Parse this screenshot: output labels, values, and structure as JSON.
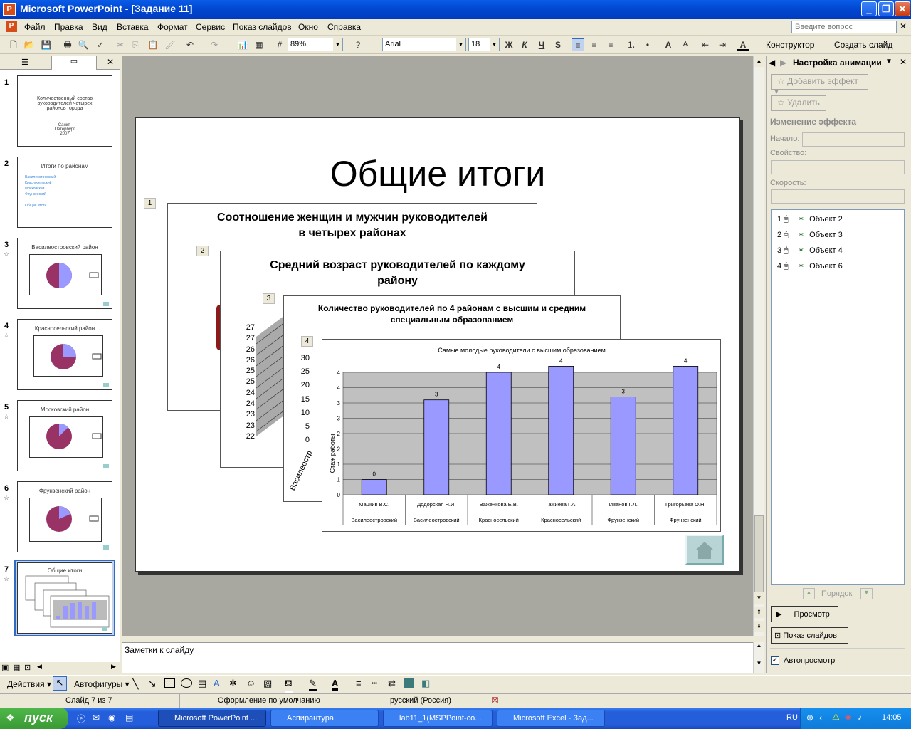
{
  "window": {
    "title": "Microsoft PowerPoint - [Задание 11]",
    "app_icon": "P"
  },
  "menu": [
    "Файл",
    "Правка",
    "Вид",
    "Вставка",
    "Формат",
    "Сервис",
    "Показ слайдов",
    "Окно",
    "Справка"
  ],
  "help_placeholder": "Введите вопрос",
  "toolbar": {
    "zoom": "89%",
    "font": "Arial",
    "size": "18",
    "designer": "Конструктор",
    "new_slide": "Создать слайд",
    "bold": "Ж",
    "italic": "К",
    "underline": "Ч",
    "shadow": "S"
  },
  "thumbnails": [
    {
      "num": "1",
      "title": "Количественный состав руководителей четырех районов города",
      "sub": "Санкт- Петербург 2007"
    },
    {
      "num": "2",
      "title": "Итоги по районам",
      "links": [
        "Василеостровский",
        "Красносельский",
        "Московский",
        "Фрунзенский",
        "Общие итоги"
      ]
    },
    {
      "num": "3",
      "title": "Василеостровский район"
    },
    {
      "num": "4",
      "title": "Красносельский район"
    },
    {
      "num": "5",
      "title": "Московский район"
    },
    {
      "num": "6",
      "title": "Фрунзенский район"
    },
    {
      "num": "7",
      "title": "Общие итоги"
    }
  ],
  "slide": {
    "title": "Общие итоги",
    "objects": [
      {
        "num": "1",
        "title_line1": "Соотношение женщин и мужчин руководителей",
        "title_line2": "в четырех районах"
      },
      {
        "num": "2",
        "title_line1": "Средний возраст руководителей по каждому",
        "title_line2": "району",
        "yticks": [
          "27",
          "27",
          "26",
          "26",
          "25",
          "25",
          "24",
          "24",
          "23",
          "23",
          "22"
        ]
      },
      {
        "num": "3",
        "title_line1": "Количество руководителей по 4 районам с высшим и средним",
        "title_line2": "специальным образованием",
        "yticks": [
          "30",
          "25",
          "20",
          "15",
          "10",
          "5",
          "0"
        ],
        "xlabel_partial": "Василеостр"
      },
      {
        "num": "4"
      }
    ]
  },
  "chart_data": {
    "type": "bar",
    "title": "Самые молодые руководители с высшим образованием",
    "ylabel": "Стаж работы",
    "ylim": [
      0,
      4
    ],
    "yticks": [
      "4",
      "4",
      "3",
      "3",
      "2",
      "2",
      "1",
      "1",
      "0"
    ],
    "categories": [
      "Мацкив В.С.",
      "Додорская Н.И.",
      "Важенкова Е.В.",
      "Тажиева Г.А.",
      "Иванов Г.Л.",
      "Григорьева О.Н."
    ],
    "districts": [
      "Василеостровский",
      "Василеостровский",
      "Красносельский",
      "Красносельский",
      "Фрунзенский",
      "Фрунзенский"
    ],
    "values": [
      0.5,
      3.1,
      4.0,
      4.2,
      3.2,
      4.2
    ],
    "data_labels": [
      "0",
      "3",
      "4",
      "4",
      "3",
      "4"
    ],
    "bar_color": "#9999ff",
    "plot_bg": "#c0c0c0"
  },
  "notes": "Заметки к слайду",
  "task_pane": {
    "title": "Настройка анимации",
    "add_effect": "Добавить эффект",
    "remove": "Удалить",
    "change_effect": "Изменение эффекта",
    "start_label": "Начало:",
    "property_label": "Свойство:",
    "speed_label": "Скорость:",
    "items": [
      {
        "n": "1",
        "label": "Объект 2"
      },
      {
        "n": "2",
        "label": "Объект 3"
      },
      {
        "n": "3",
        "label": "Объект 4"
      },
      {
        "n": "4",
        "label": "Объект 6"
      }
    ],
    "order": "Порядок",
    "preview": "Просмотр",
    "slideshow": "Показ слайдов",
    "autopreview": "Автопросмотр"
  },
  "drawbar": {
    "actions": "Действия",
    "autoshapes": "Автофигуры"
  },
  "status": {
    "slide": "Слайд 7 из 7",
    "design": "Оформление по умолчанию",
    "lang": "русский (Россия)"
  },
  "taskbar": {
    "start": "пуск",
    "tasks": [
      "Microsoft PowerPoint ...",
      "Аспирантура",
      "lab11_1(MSPPoint-co...",
      "Microsoft Excel - Зад..."
    ],
    "lang": "RU",
    "time": "14:05"
  }
}
